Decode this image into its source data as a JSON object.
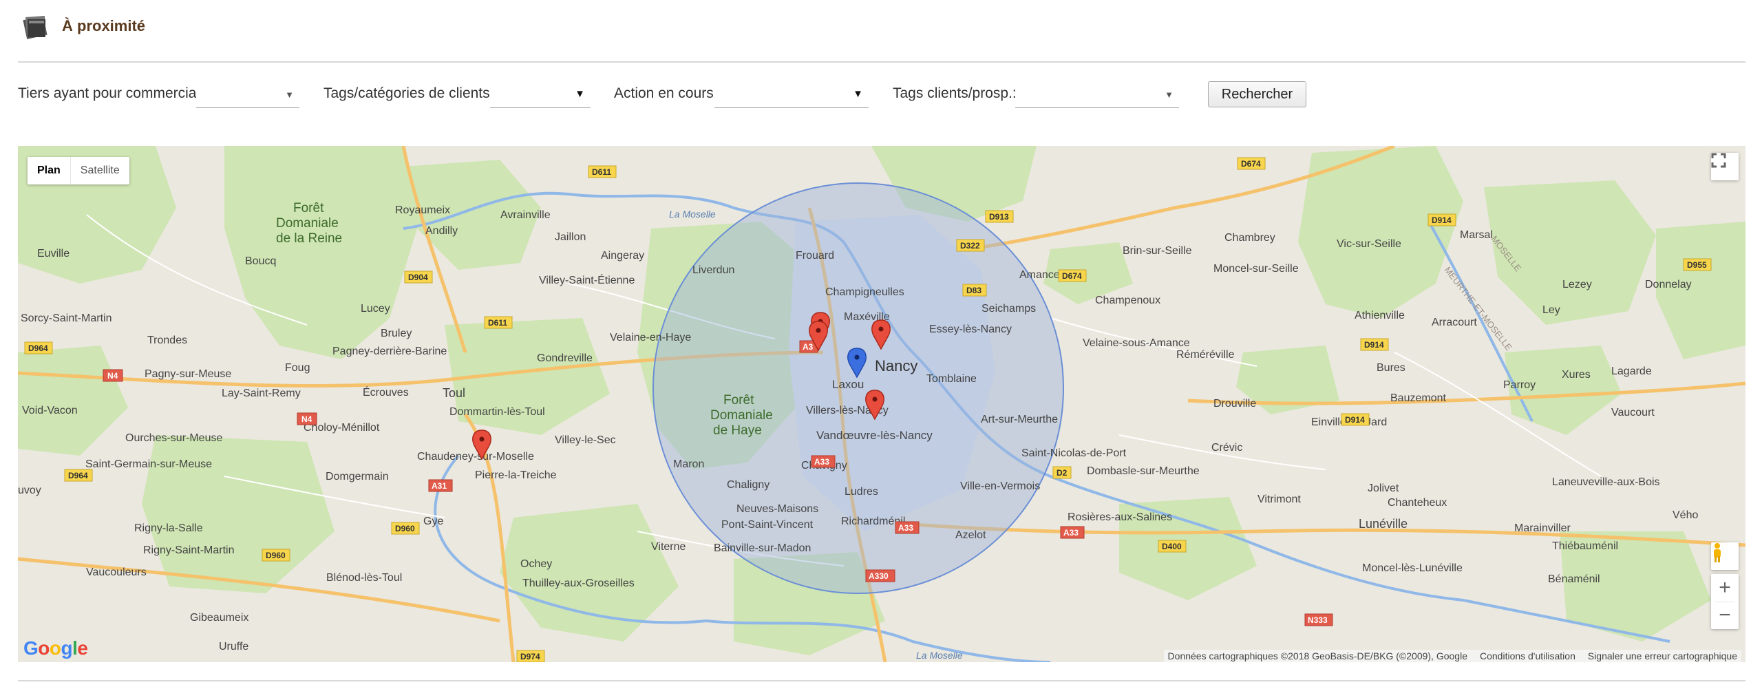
{
  "header": {
    "title": "À proximité",
    "icon": "folder-stack-icon"
  },
  "filters": {
    "commercial_label": "Tiers ayant pour commercial:",
    "commercial_value": "",
    "tags_label": "Tags/catégories de clients:",
    "tags_value": "",
    "action_label": "Action en cours:",
    "action_value": "",
    "tags_prosp_label": "Tags clients/prosp.:",
    "tags_prosp_value": "",
    "search_button": "Rechercher"
  },
  "map": {
    "type_plan": "Plan",
    "type_satellite": "Satellite",
    "attribution": "Données cartographiques ©2018 GeoBasis-DE/BKG (©2009), Google",
    "terms": "Conditions d'utilisation",
    "report": "Signaler une erreur cartographique",
    "logo": "Google",
    "zoom_in": "+",
    "zoom_out": "−",
    "colors": {
      "radius_fill": "#9db3dc",
      "marker_red": "#e74c3c",
      "marker_blue": "#3b6fe0"
    },
    "places": {
      "nancy": "Nancy",
      "laxou": "Laxou",
      "villers": "Villers-lès-Nancy",
      "vandoeuvre": "Vandœuvre-lès-Nancy",
      "maxeville": "Maxéville",
      "champigneulles": "Champigneulles",
      "frouard": "Frouard",
      "liverdun": "Liverdun",
      "essey": "Essey-lès-Nancy",
      "seichamps": "Seichamps",
      "tomblaine": "Tomblaine",
      "amance": "Amance",
      "champenoux": "Champenoux",
      "velaine_amance": "Velaine-sous-Amance",
      "remereville": "Réméréville",
      "athienville": "Athienville",
      "arracourt": "Arracourt",
      "bures": "Bures",
      "parroy": "Parroy",
      "xures": "Xures",
      "lagarde": "Lagarde",
      "vaucourt": "Vaucourt",
      "lezey": "Lezey",
      "donnelay": "Donnelay",
      "ley": "Ley",
      "moncel": "Moncel-sur-Seille",
      "vic": "Vic-sur-Seille",
      "chambrey": "Chambrey",
      "brin": "Brin-sur-Seille",
      "marsal": "Marsal",
      "drouville": "Drouville",
      "bauzemont": "Bauzemont",
      "einville": "Einville-au-Jard",
      "crevic": "Crévic",
      "art": "Art-sur-Meurthe",
      "st_nicolas": "Saint-Nicolas-de-Port",
      "dombasle": "Dombasle-sur-Meurthe",
      "ville_vermois": "Ville-en-Vermois",
      "rosieres": "Rosières-aux-Salines",
      "vitrimont": "Vitrimont",
      "jolivet": "Jolivet",
      "chanteheux": "Chanteheux",
      "luneville": "Lunéville",
      "laneuveville": "Laneuveville-aux-Bois",
      "marainviller": "Marainviller",
      "thiebaumenil": "Thiébauménil",
      "moncel_lun": "Moncel-lès-Lunéville",
      "benamenil": "Bénaménil",
      "veho": "Vého",
      "azelot": "Azelot",
      "richardmenil": "Richardménil",
      "ludres": "Ludres",
      "chavigny": "Chavigny",
      "maron": "Maron",
      "chaligny": "Chaligny",
      "neuves": "Neuves-Maisons",
      "pont_st_vincent": "Pont-Saint-Vincent",
      "bainville": "Bainville-sur-Madon",
      "viterne": "Viterne",
      "ochey": "Ochey",
      "thuilley": "Thuilley-aux-Groseilles",
      "foret_haye_1": "Forêt",
      "foret_haye_2": "Domaniale",
      "foret_haye_3": "de Haye",
      "velaine_haye": "Velaine-en-Haye",
      "aingeray": "Aingeray",
      "villey_st_etienne": "Villey-Saint-Étienne",
      "jaillon": "Jaillon",
      "avrainville": "Avrainville",
      "royaumeix": "Royaumeix",
      "andilly": "Andilly",
      "boucq": "Boucq",
      "euville": "Euville",
      "foret_reine_1": "Forêt",
      "foret_reine_2": "Domaniale",
      "foret_reine_3": "de la Reine",
      "lucey": "Lucey",
      "bruley": "Bruley",
      "trondes": "Trondes",
      "sorcy": "Sorcy-Saint-Martin",
      "pagney": "Pagney-derrière-Barine",
      "foug": "Foug",
      "gondreville": "Gondreville",
      "lay": "Lay-Saint-Remy",
      "pagny": "Pagny-sur-Meuse",
      "ecrouves": "Écrouves",
      "toul": "Toul",
      "dommartin": "Dommartin-lès-Toul",
      "choloy": "Choloy-Ménillot",
      "void": "Void-Vacon",
      "ourches": "Ourches-sur-Meuse",
      "villey_sec": "Villey-le-Sec",
      "chaudeney": "Chaudeney-sur-Moselle",
      "pierre": "Pierre-la-Treiche",
      "domgermain": "Domgermain",
      "st_germain": "Saint-Germain-sur-Meuse",
      "uvoy": "uvoy",
      "rigny_salle": "Rigny-la-Salle",
      "rigny_martin": "Rigny-Saint-Martin",
      "gye": "Gye",
      "vaucouleurs": "Vaucouleurs",
      "blenod": "Blénod-lès-Toul",
      "gibeaumeix": "Gibeaumeix",
      "uruffe": "Uruffe",
      "moselle": "La Moselle",
      "moselle2": "La Moselle",
      "meurthe": "MEURTHE-ET-MOSELLE",
      "moselle_dept": "MOSELLE"
    },
    "roads": {
      "d611a": "D611",
      "d611b": "D611",
      "d904": "D904",
      "d964a": "D964",
      "d964b": "D964",
      "n4a": "N4",
      "n4b": "N4",
      "a31": "A31",
      "d960a": "D960",
      "d960b": "D960",
      "d974": "D974",
      "a3": "A3",
      "a33a": "A33",
      "a33b": "A33",
      "a33c": "A33",
      "a330": "A330",
      "d913": "D913",
      "d322": "D322",
      "d83": "D83",
      "d674a": "D674",
      "d674b": "D674",
      "d914a": "D914",
      "d914b": "D914",
      "d914c": "D914",
      "d955": "D955",
      "d2": "D2",
      "d400": "D400",
      "n333": "N333"
    }
  }
}
